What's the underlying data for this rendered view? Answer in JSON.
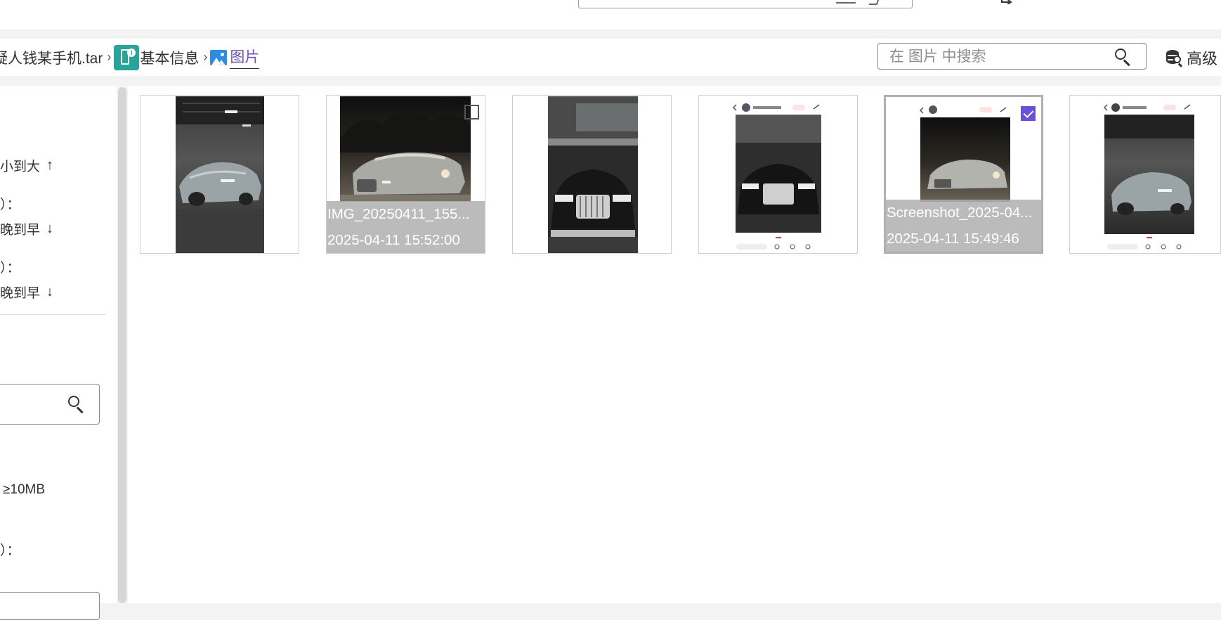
{
  "breadcrumb": {
    "items": [
      {
        "label": "疑人钱某手机.tar"
      },
      {
        "label": "基本信息",
        "icon": "phone-info-icon"
      },
      {
        "label": "图片",
        "icon": "image-icon"
      }
    ],
    "separator": "›"
  },
  "search": {
    "placeholder": "在 图片 中搜索",
    "value": ""
  },
  "advanced": {
    "label": "高级",
    "icon": "database-search-icon"
  },
  "sidebar": {
    "sort_size": "小到大",
    "label_2": "）：",
    "sort_time_1": "晚到早",
    "label_3": "）：",
    "sort_time_2": "晚到早",
    "size_option": "≥10MB",
    "label_4": "）：",
    "arrows": {
      "up": "↑",
      "down": "↓"
    },
    "filter_value": ""
  },
  "gallery": {
    "items": [
      {
        "title": "",
        "date": "",
        "kind": "photo-porsche",
        "checked": false
      },
      {
        "title": "IMG_20250411_155...",
        "date": "2025-04-11 15:52:00",
        "kind": "photo-sedan-night",
        "checked": false
      },
      {
        "title": "",
        "date": "",
        "kind": "photo-maybach",
        "checked": false
      },
      {
        "title": "",
        "date": "",
        "kind": "screenshot-maybach",
        "checked": false
      },
      {
        "title": "Screenshot_2025-04...",
        "date": "2025-04-11 15:49:46",
        "kind": "screenshot-sedan-night",
        "checked": true
      },
      {
        "title": "",
        "date": "",
        "kind": "screenshot-porsche",
        "checked": false
      }
    ]
  },
  "colors": {
    "accent": "#6a4fe0",
    "teal": "#26a69a",
    "link": "#6b4fd8"
  }
}
